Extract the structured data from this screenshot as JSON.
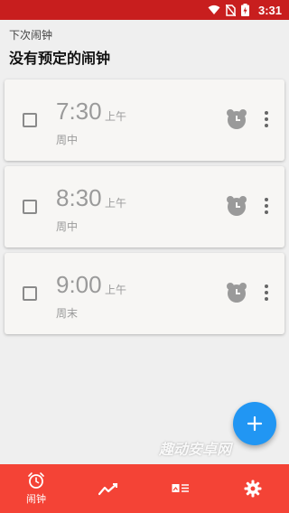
{
  "colors": {
    "status_bar": "#c81e1e",
    "bottom_nav": "#f44336",
    "fab": "#2196f3",
    "card": "#f7f6f4",
    "muted_text": "#9a9a9a"
  },
  "status_bar": {
    "time": "3:31",
    "icons": [
      "wifi-icon",
      "no-sim-icon",
      "battery-charging-icon"
    ]
  },
  "header": {
    "next_label": "下次闹钟",
    "title": "没有预定的闹钟"
  },
  "alarms": [
    {
      "time": "7:30",
      "ampm": "上午",
      "repeat": "周中",
      "enabled": false
    },
    {
      "time": "8:30",
      "ampm": "上午",
      "repeat": "周中",
      "enabled": false
    },
    {
      "time": "9:00",
      "ampm": "上午",
      "repeat": "周末",
      "enabled": false
    }
  ],
  "fab": {
    "icon": "plus-icon"
  },
  "watermark": "趣动安卓网",
  "bottom_nav": {
    "items": [
      {
        "icon": "alarm-clock-icon",
        "label": "闹钟",
        "active": true
      },
      {
        "icon": "trend-chart-icon",
        "label": ""
      },
      {
        "icon": "card-list-icon",
        "label": ""
      },
      {
        "icon": "gear-icon",
        "label": ""
      }
    ]
  }
}
